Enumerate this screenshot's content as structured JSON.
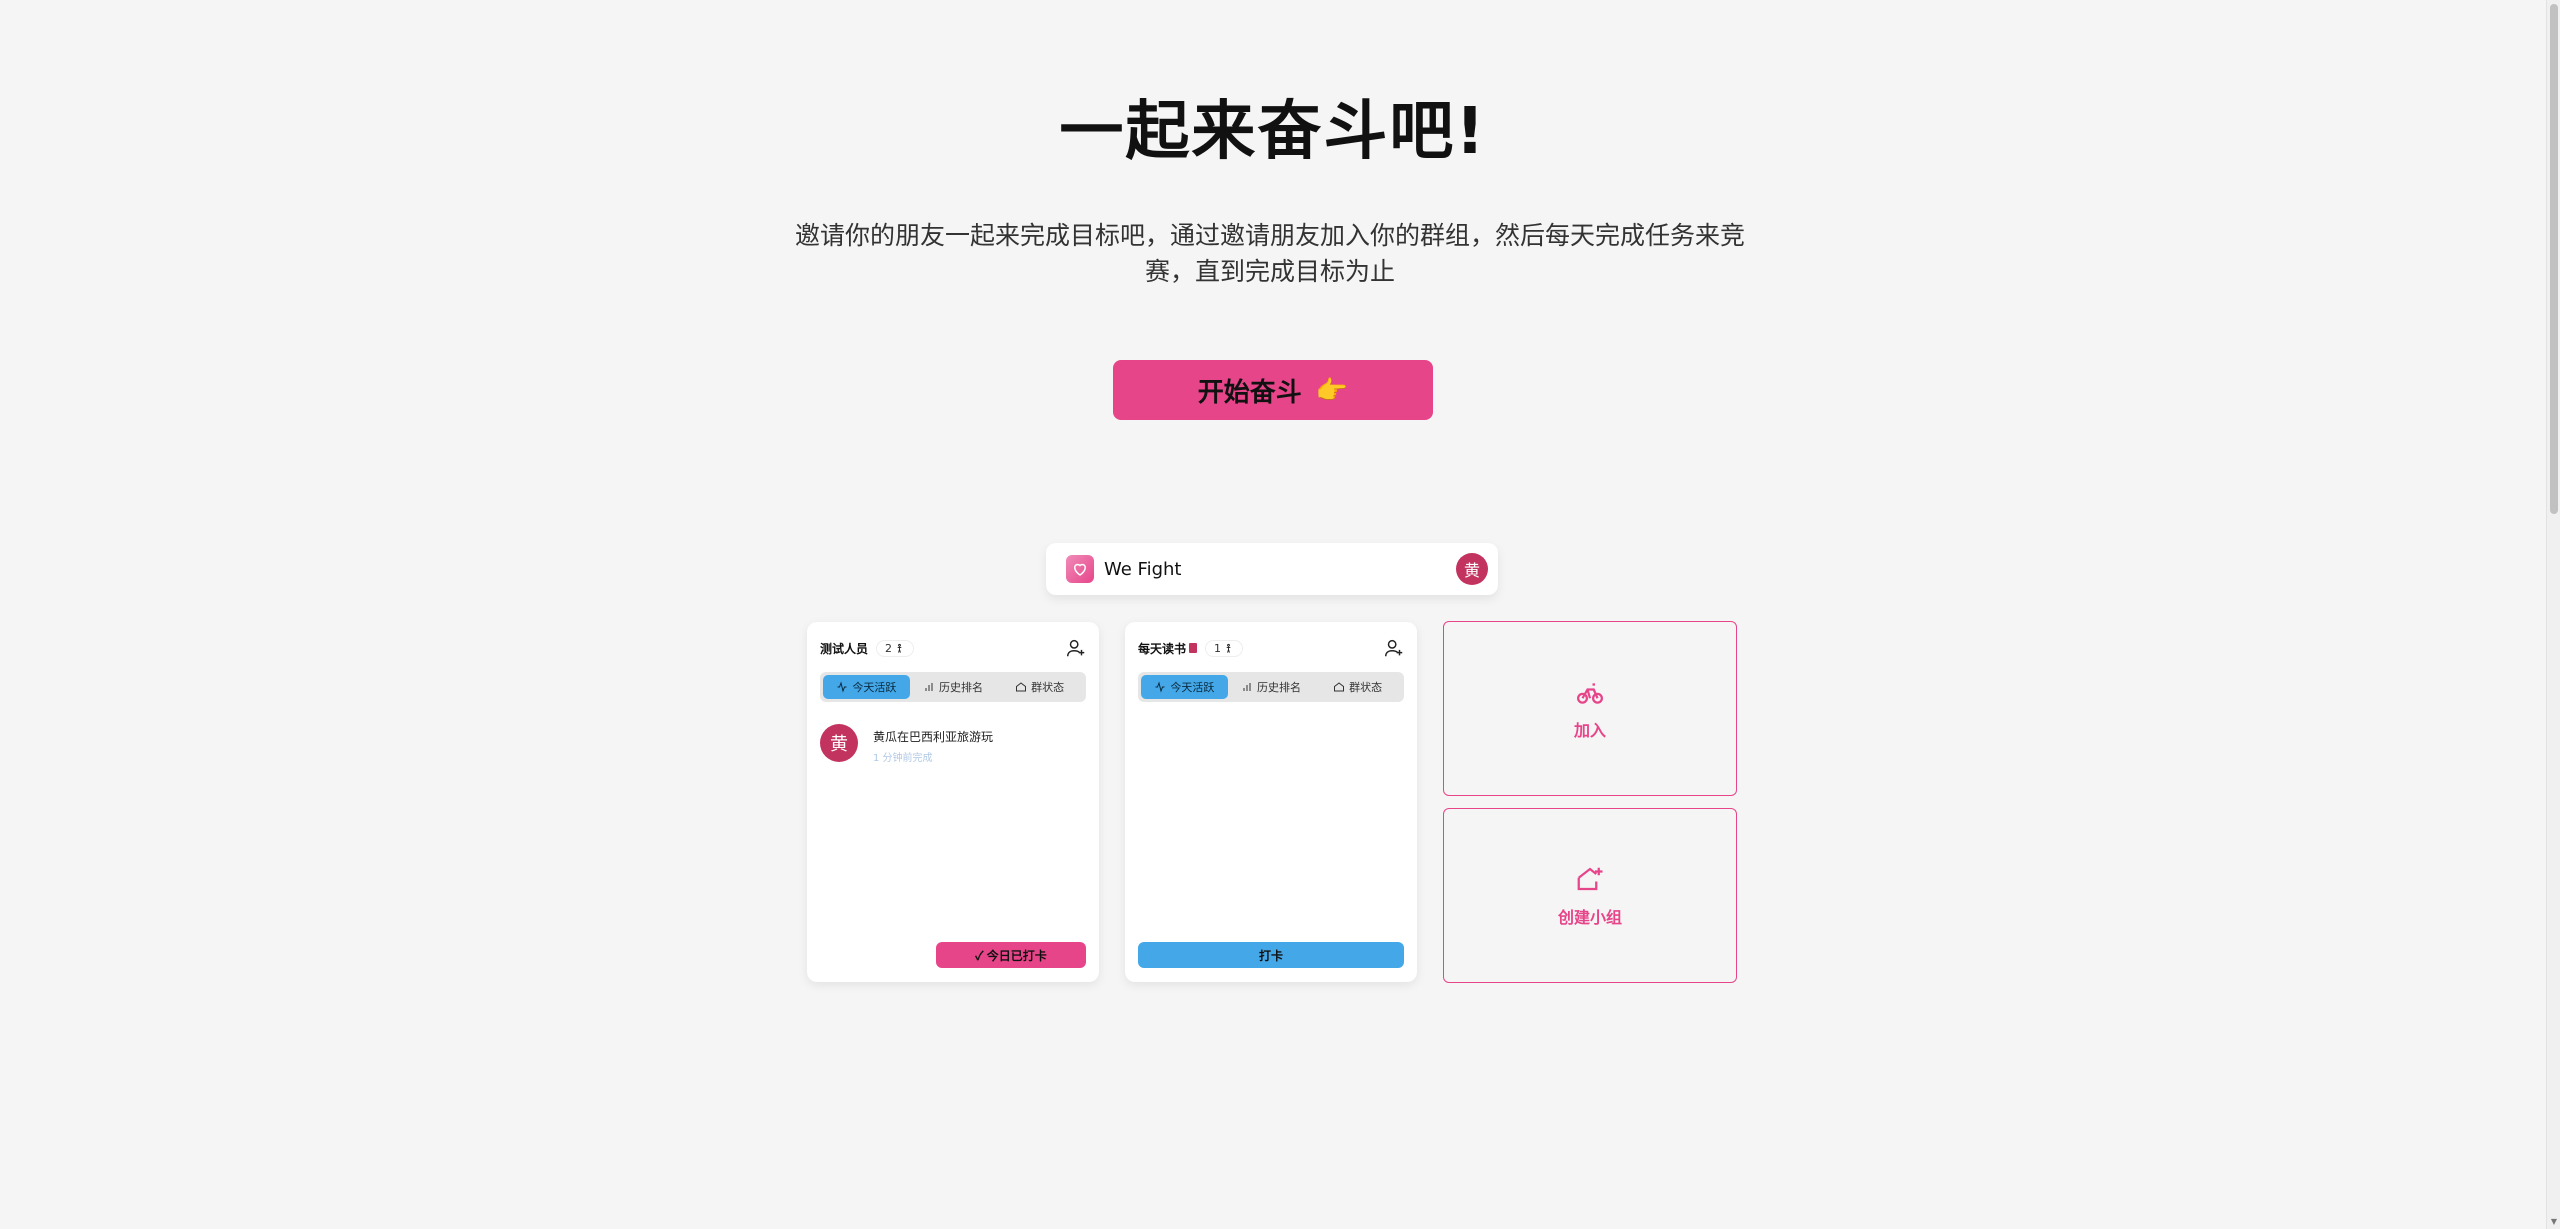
{
  "hero": {
    "title": "一起来奋斗吧!",
    "subtitle": "邀请你的朋友一起来完成目标吧，通过邀请朋友加入你的群组，然后每天完成任务来竞赛，直到完成目标为止",
    "cta_label": "开始奋斗",
    "cta_emoji": "👉"
  },
  "app_bar": {
    "name": "We Fight",
    "avatar_text": "黄"
  },
  "groups": [
    {
      "name": "测试人员",
      "members": "2",
      "tabs": [
        "今天活跃",
        "历史排名",
        "群状态"
      ],
      "feed": [
        {
          "avatar": "黄",
          "message": "黄瓜在巴西利亚旅游玩",
          "time": "1 分钟前完成"
        }
      ],
      "action_label": "✓ 今日已打卡"
    },
    {
      "name": "每天读书",
      "members": "1",
      "tabs": [
        "今天活跃",
        "历史排名",
        "群状态"
      ],
      "feed": [],
      "action_label": "打卡"
    }
  ],
  "tiles": {
    "join_label": "加入",
    "create_label": "创建小组"
  },
  "colors": {
    "accent": "#e7458a",
    "blue": "#44a8e8",
    "avatar": "#c2335f",
    "background": "#f5f5f5"
  }
}
